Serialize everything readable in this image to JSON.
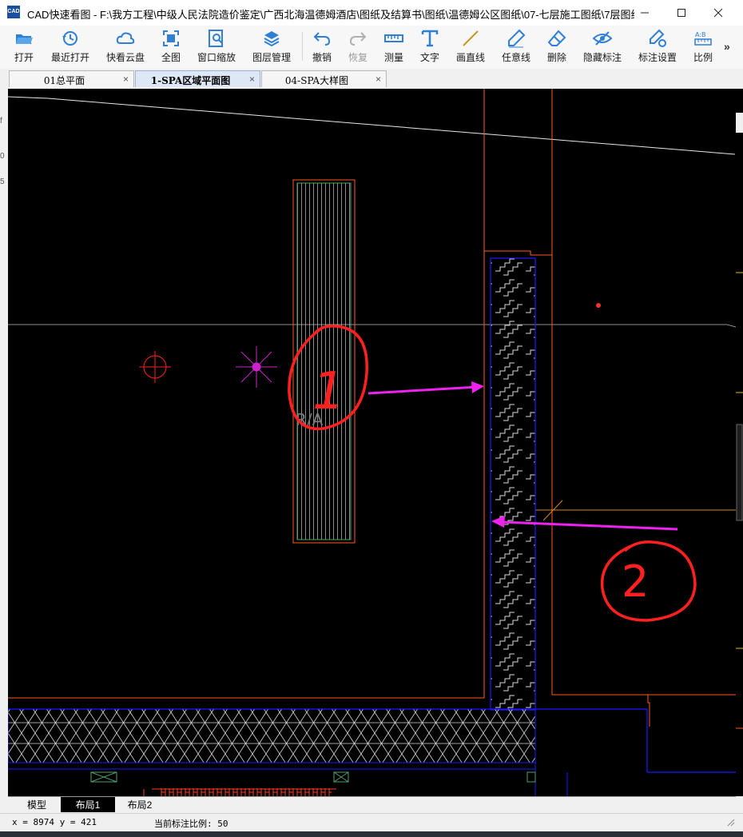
{
  "window": {
    "app_icon_text": "CAD",
    "title": "CAD快速看图 - F:\\我方工程\\中级人民法院造价鉴定\\广西北海温德姆酒店\\图纸及结算书\\图纸\\温德姆公区图纸\\07-七层施工图纸\\7层图纸\\0...",
    "controls": {
      "minimize": "minimize-icon",
      "maximize": "maximize-icon",
      "close": "close-icon"
    }
  },
  "toolbar": {
    "items": [
      {
        "label": "打开",
        "icon": "folder-open-icon"
      },
      {
        "label": "最近打开",
        "icon": "clock-history-icon"
      },
      {
        "label": "快看云盘",
        "icon": "cloud-icon"
      },
      {
        "label": "全图",
        "icon": "fit-view-icon"
      },
      {
        "label": "窗口缩放",
        "icon": "zoom-window-icon"
      },
      {
        "label": "图层管理",
        "icon": "layers-icon"
      },
      {
        "label": "撤销",
        "icon": "undo-icon"
      },
      {
        "label": "恢复",
        "icon": "redo-icon",
        "disabled": true
      },
      {
        "label": "测量",
        "icon": "ruler-icon"
      },
      {
        "label": "文字",
        "icon": "text-icon"
      },
      {
        "label": "画直线",
        "icon": "line-icon"
      },
      {
        "label": "任意线",
        "icon": "pen-icon"
      },
      {
        "label": "删除",
        "icon": "eraser-icon"
      },
      {
        "label": "隐藏标注",
        "icon": "eye-hidden-icon"
      },
      {
        "label": "标注设置",
        "icon": "settings-pen-icon"
      },
      {
        "label": "比例",
        "icon": "scale-ratio-icon"
      }
    ],
    "more": "»"
  },
  "left_strip": {
    "marks": [
      "f",
      "0",
      "5"
    ]
  },
  "tabs": [
    {
      "label": "01总平面",
      "active": false,
      "close": "×"
    },
    {
      "label": "1-SPA区域平面图",
      "active": true,
      "close": "×"
    },
    {
      "label": "04-SPA大样图",
      "active": false,
      "close": "×"
    }
  ],
  "drawing": {
    "text_ra": "R/A",
    "annotations": [
      {
        "label": "1",
        "shape": "circled number"
      },
      {
        "label": "2",
        "shape": "circled number"
      }
    ],
    "colors": {
      "background": "#000000",
      "wall_orange": "#ff5a1e",
      "wall_blue": "#1a1aff",
      "hatch_white": "#e6e6e6",
      "annotation_red": "#ff2020",
      "arrow_magenta": "#ee22ee",
      "symbol_magenta": "#cc22cc",
      "column_green": "#4f9f6b",
      "orange_line": "#d88a1a"
    }
  },
  "layout_tabs": [
    {
      "label": "模型",
      "active": false
    },
    {
      "label": "布局1",
      "active": true
    },
    {
      "label": "布局2",
      "active": false
    }
  ],
  "status": {
    "coords": "x = 8974  y = 421",
    "scale": "当前标注比例: 50"
  }
}
